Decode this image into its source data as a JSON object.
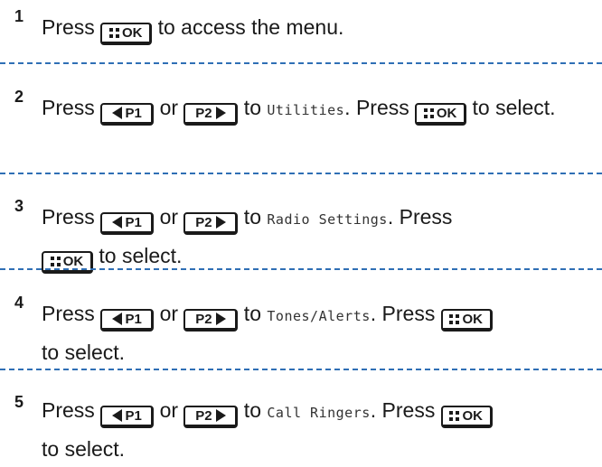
{
  "steps": [
    {
      "number": "1",
      "before": "Press ",
      "ok_key": "OK",
      "after": " to access the menu."
    },
    {
      "number": "2",
      "press": "Press ",
      "p1_key": "P1",
      "or": " or ",
      "p2_key": "P2",
      "to": " to ",
      "menu_item": "Utilities",
      "press2": ". Press ",
      "ok_key": "OK",
      "select": " to select."
    },
    {
      "number": "3",
      "press": "Press ",
      "p1_key": "P1",
      "or": " or ",
      "p2_key": "P2",
      "to": " to ",
      "menu_item": "Radio Settings",
      "press2": ". Press",
      "ok_key": "OK",
      "select": " to select."
    },
    {
      "number": "4",
      "press": "Press ",
      "p1_key": "P1",
      "or": " or ",
      "p2_key": "P2",
      "to": " to ",
      "menu_item": "Tones/Alerts",
      "press2": ". Press ",
      "ok_key": "OK",
      "select": "to select."
    },
    {
      "number": "5",
      "press": "Press ",
      "p1_key": "P1",
      "or": " or ",
      "p2_key": "P2",
      "to": " to ",
      "menu_item": "Call Ringers",
      "press2": ". Press ",
      "ok_key": "OK",
      "select": "to select."
    }
  ],
  "colors": {
    "divider": "#2f6fb5",
    "text": "#1a1a1a"
  },
  "icons": {
    "ok_key": "menu-ok-key-icon",
    "p1_key": "left-p1-key-icon",
    "p2_key": "right-p2-key-icon"
  }
}
